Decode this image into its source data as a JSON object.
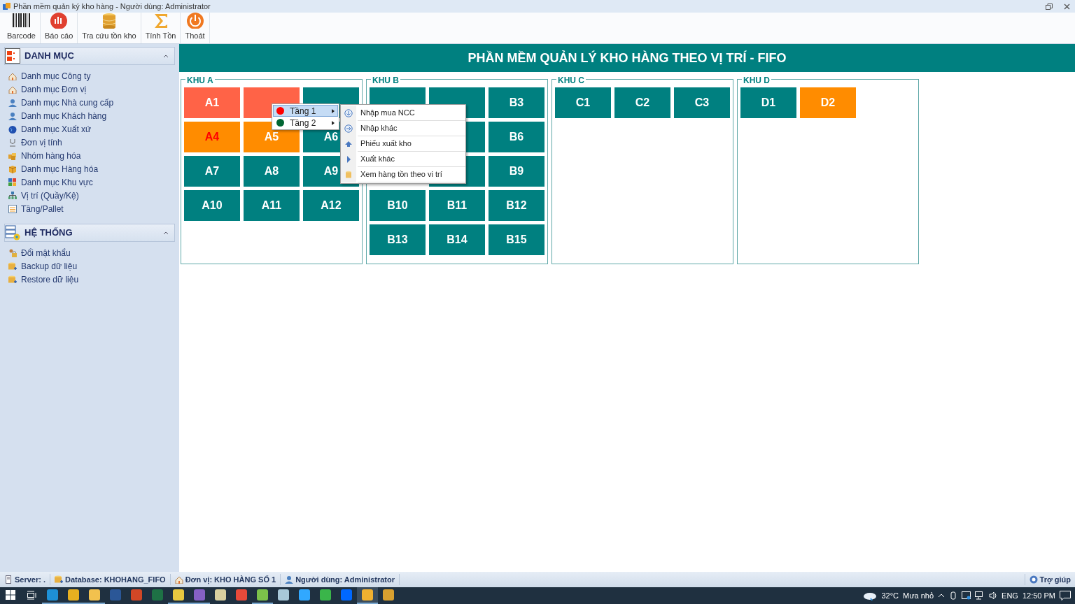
{
  "window": {
    "title": "Phần mềm quản ký kho hàng - Người dùng: Administrator"
  },
  "toolbar": [
    {
      "label": "Barcode",
      "kind": "barcode"
    },
    {
      "label": "Báo cáo",
      "kind": "report"
    },
    {
      "label": "Tra cứu tồn kho",
      "kind": "database"
    },
    {
      "label": "Tính Tồn",
      "kind": "sigma"
    },
    {
      "label": "Thoát",
      "kind": "power"
    }
  ],
  "sidebar": [
    {
      "title": "DANH MỤC",
      "kind": "catalog",
      "expanded": true,
      "items": [
        {
          "label": "Danh mục Công ty",
          "kind": "house"
        },
        {
          "label": "Danh mục Đơn vị",
          "kind": "house"
        },
        {
          "label": "Danh mục Nhà cung cấp",
          "kind": "person"
        },
        {
          "label": "Danh mục Khách hàng",
          "kind": "person"
        },
        {
          "label": "Danh mục Xuất xứ",
          "kind": "globe"
        },
        {
          "label": "Đơn vị tính",
          "kind": "unit"
        },
        {
          "label": "Nhóm hàng hóa",
          "kind": "boxes"
        },
        {
          "label": "Danh mục Hàng hóa",
          "kind": "box"
        },
        {
          "label": "Danh mục Khu vực",
          "kind": "grid"
        },
        {
          "label": "Vị trí (Quầy/Kệ)",
          "kind": "tree"
        },
        {
          "label": "Tầng/Pallet",
          "kind": "list"
        }
      ]
    },
    {
      "title": "HỆ THỐNG",
      "kind": "system",
      "expanded": true,
      "items": [
        {
          "label": "Đổi mật khẩu",
          "kind": "lock"
        },
        {
          "label": "Backup dữ liệu",
          "kind": "db"
        },
        {
          "label": "Restore dữ liệu",
          "kind": "db"
        }
      ]
    }
  ],
  "header": "PHẦN MỀM QUẢN LÝ KHO HÀNG THEO VỊ TRÍ - FIFO",
  "zones": [
    {
      "title": "KHU A",
      "rows": [
        {
          "tiles": [
            {
              "label": "A1",
              "color": "#ff6347",
              "alert": false
            },
            {
              "color": "#ff6347"
            },
            {
              "color": "#008080"
            }
          ]
        },
        {
          "tiles": [
            {
              "label": "A4",
              "color": "#ff8c00",
              "alert": true
            },
            {
              "label": "A5",
              "color": "#ff8c00",
              "alert": false
            },
            {
              "label": "A6",
              "color": "#008080",
              "alert": false
            }
          ]
        },
        {
          "tiles": [
            {
              "label": "A7",
              "color": "#008080",
              "alert": false
            },
            {
              "label": "A8",
              "color": "#008080",
              "alert": false
            },
            {
              "label": "A9",
              "color": "#008080",
              "alert": false
            }
          ]
        },
        {
          "tiles": [
            {
              "label": "A10",
              "color": "#008080",
              "alert": false
            },
            {
              "label": "A11",
              "color": "#008080",
              "alert": false
            },
            {
              "label": "A12",
              "color": "#008080",
              "alert": false
            }
          ]
        }
      ]
    },
    {
      "title": "KHU B",
      "rows": [
        {
          "tiles": [
            {
              "color": "#008080"
            },
            {
              "color": "#008080"
            },
            {
              "label": "B3",
              "color": "#008080"
            }
          ]
        },
        {
          "tiles": [
            {
              "color": "#008080"
            },
            {
              "label": "B6",
              "color": "#008080"
            }
          ]
        },
        {
          "tiles": [
            {
              "color": "#008080"
            },
            {
              "label": "B9",
              "color": "#008080"
            }
          ]
        },
        {
          "tiles": [
            {
              "label": "B10",
              "color": "#008080"
            },
            {
              "label": "B11",
              "color": "#008080"
            },
            {
              "label": "B12",
              "color": "#008080"
            }
          ]
        },
        {
          "tiles": [
            {
              "label": "B13",
              "color": "#008080"
            },
            {
              "label": "B14",
              "color": "#008080"
            },
            {
              "label": "B15",
              "color": "#008080"
            }
          ]
        }
      ]
    },
    {
      "title": "KHU C",
      "rows": [
        {
          "tiles": [
            {
              "label": "C1",
              "color": "#008080"
            },
            {
              "label": "C2",
              "color": "#008080"
            },
            {
              "label": "C3",
              "color": "#008080"
            }
          ]
        }
      ]
    },
    {
      "title": "KHU D",
      "rows": [
        {
          "tiles": [
            {
              "label": "D1",
              "color": "#008080"
            },
            {
              "label": "D2",
              "color": "#ff8c00"
            }
          ]
        }
      ]
    }
  ],
  "context_menu": {
    "items": [
      {
        "label": "Tầng 1",
        "color": "#ff0000",
        "selected": true
      },
      {
        "label": "Tầng 2",
        "color": "#006633",
        "selected": false
      }
    ],
    "submenu": [
      {
        "label": "Nhập mua NCC",
        "kind": "down"
      },
      {
        "label": "Nhập khác",
        "kind": "right"
      },
      {
        "label": "Phiếu xuất kho",
        "kind": "up"
      },
      {
        "label": "Xuất khác",
        "kind": "play"
      },
      {
        "label": "Xem hàng tồn theo vi trí",
        "kind": "db"
      }
    ]
  },
  "status_bar": {
    "items": [
      {
        "label": "Server: .",
        "kind": "server"
      },
      {
        "label": "Database: KHOHANG_FIFO",
        "kind": "db"
      },
      {
        "label": "Đơn vị: KHO HÀNG SỐ 1",
        "kind": "house"
      },
      {
        "label": "Người dùng: Administrator",
        "kind": "person"
      }
    ],
    "help": "Trợ giúp"
  },
  "taskbar": {
    "apps": [
      {
        "color": "#1e90d6",
        "running": true,
        "selected": false
      },
      {
        "color": "#e8b020",
        "running": true,
        "selected": false
      },
      {
        "color": "#f2c14e",
        "running": true,
        "selected": false
      },
      {
        "color": "#2b5797",
        "running": false,
        "selected": false
      },
      {
        "color": "#d24726",
        "running": false,
        "selected": false
      },
      {
        "color": "#1e7145",
        "running": false,
        "selected": false
      },
      {
        "color": "#e8c840",
        "running": true,
        "selected": false
      },
      {
        "color": "#8661c5",
        "running": true,
        "selected": false
      },
      {
        "color": "#d8d0a0",
        "running": false,
        "selected": false
      },
      {
        "color": "#e84a3a",
        "running": false,
        "selected": false
      },
      {
        "color": "#7cc24a",
        "running": true,
        "selected": false
      },
      {
        "color": "#a8c8d8",
        "running": false,
        "selected": false
      },
      {
        "color": "#31a8ff",
        "running": false,
        "selected": false
      },
      {
        "color": "#3ab54a",
        "running": false,
        "selected": false
      },
      {
        "color": "#0068ff",
        "running": false,
        "selected": false
      },
      {
        "color": "#f0b030",
        "running": true,
        "selected": true
      },
      {
        "color": "#d8a030",
        "running": false,
        "selected": false
      }
    ],
    "temperature": "32°C",
    "weather": "Mưa nhỏ",
    "language": "ENG",
    "time": "12:50 PM"
  }
}
